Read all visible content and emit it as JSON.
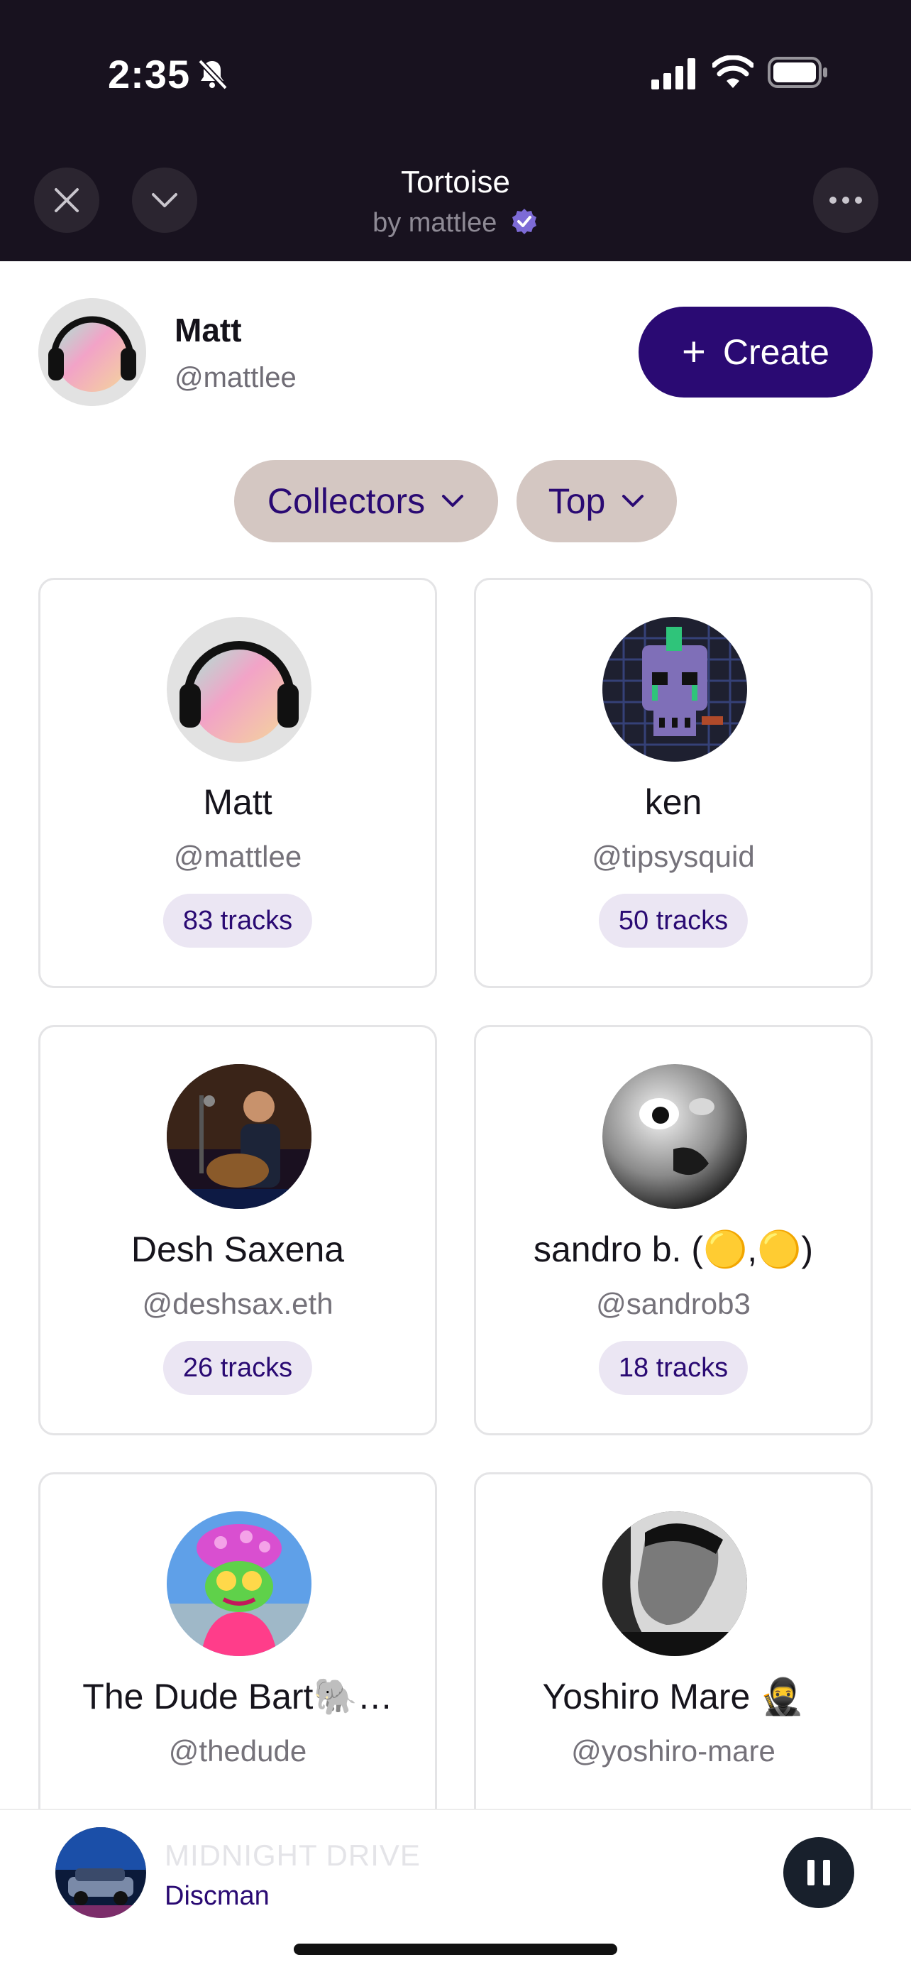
{
  "status_bar": {
    "time": "2:35"
  },
  "header": {
    "title": "Tortoise",
    "byline": "by mattlee"
  },
  "profile": {
    "name": "Matt",
    "handle": "@mattlee",
    "create_label": "Create"
  },
  "filters": {
    "primary": "Collectors",
    "sort": "Top"
  },
  "collectors": [
    {
      "name": "Matt",
      "handle": "@mattlee",
      "tracks": "83 tracks"
    },
    {
      "name": "ken",
      "handle": "@tipsysquid",
      "tracks": "50 tracks"
    },
    {
      "name": "Desh Saxena",
      "handle": "@deshsax.eth",
      "tracks": "26 tracks"
    },
    {
      "name": "sandro b. (🟡,🟡)",
      "handle": "@sandrob3",
      "tracks": "18 tracks"
    },
    {
      "name": "The Dude Bart🐘…",
      "handle": "@thedude",
      "tracks": ""
    },
    {
      "name": "Yoshiro Mare 🥷",
      "handle": "@yoshiro-mare",
      "tracks": ""
    }
  ],
  "player": {
    "title": "MIDNIGHT DRIVE",
    "artist": "Discman"
  },
  "colors": {
    "brand": "#2a0a73",
    "header_bg": "#18121f",
    "chip_bg": "#d4c7c2",
    "badge_bg": "#ebe6f3"
  }
}
